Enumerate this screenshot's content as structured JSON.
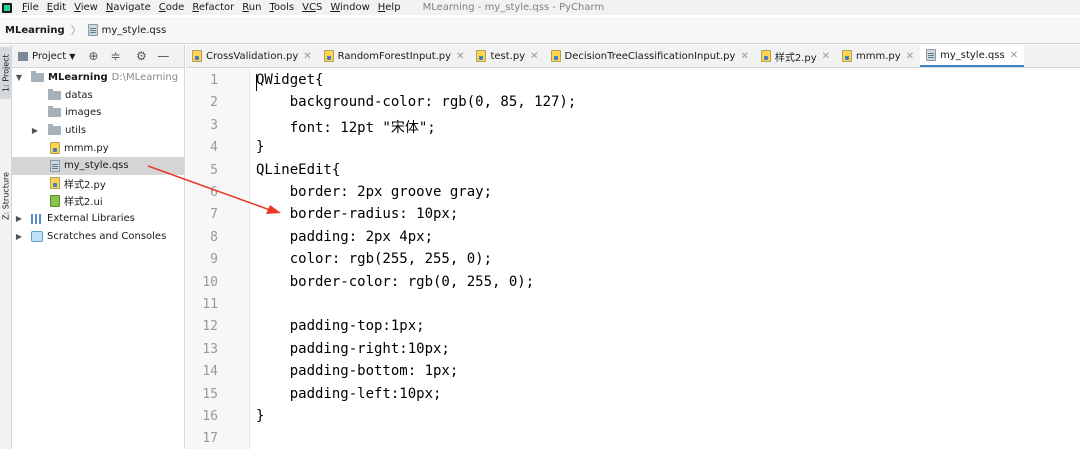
{
  "menubar": {
    "items": [
      {
        "first": "F",
        "rest": "ile"
      },
      {
        "first": "E",
        "rest": "dit"
      },
      {
        "first": "V",
        "rest": "iew"
      },
      {
        "first": "N",
        "rest": "avigate"
      },
      {
        "first": "C",
        "rest": "ode"
      },
      {
        "first": "R",
        "rest": "efactor"
      },
      {
        "first": "R",
        "rest": "un"
      },
      {
        "first": "T",
        "rest": "ools"
      },
      {
        "first": "VC",
        "rest": "S"
      },
      {
        "first": "W",
        "rest": "indow"
      },
      {
        "first": "H",
        "rest": "elp"
      }
    ],
    "window_title": "MLearning - my_style.qss - PyCharm"
  },
  "breadcrumb": {
    "project": "MLearning",
    "file": "my_style.qss"
  },
  "toolstrip": {
    "project_tab": "1: Project",
    "structure_tab": "Z: Structure"
  },
  "project_panel": {
    "title": "Project",
    "tree": [
      {
        "label": "MLearning",
        "path": "D:\\MLearning",
        "type": "folder",
        "expanded": true
      },
      {
        "label": "datas",
        "type": "folder"
      },
      {
        "label": "images",
        "type": "folder"
      },
      {
        "label": "utils",
        "type": "folder",
        "collapsed": true
      },
      {
        "label": "mmm.py",
        "type": "py"
      },
      {
        "label": "my_style.qss",
        "type": "qss",
        "selected": true
      },
      {
        "label": "样式2.py",
        "type": "py"
      },
      {
        "label": "样式2.ui",
        "type": "ui"
      },
      {
        "label": "External Libraries",
        "type": "lib"
      },
      {
        "label": "Scratches and Consoles",
        "type": "scratch"
      }
    ]
  },
  "tabs": [
    {
      "label": "CrossValidation.py"
    },
    {
      "label": "RandomForestInput.py"
    },
    {
      "label": "test.py"
    },
    {
      "label": "DecisionTreeClassificationInput.py"
    },
    {
      "label": "样式2.py"
    },
    {
      "label": "mmm.py"
    },
    {
      "label": "my_style.qss",
      "active": true
    }
  ],
  "editor": {
    "line_numbers": [
      "1",
      "2",
      "3",
      "4",
      "5",
      "6",
      "7",
      "8",
      "9",
      "10",
      "11",
      "12",
      "13",
      "14",
      "15",
      "16",
      "17"
    ],
    "lines": [
      "QWidget{",
      "    background-color: rgb(0, 85, 127);",
      "    font: 12pt \"宋体\";",
      "}",
      "QLineEdit{",
      "    border: 2px groove gray;",
      "    border-radius: 10px;",
      "    padding: 2px 4px;",
      "    color: rgb(255, 255, 0);",
      "    border-color: rgb(0, 255, 0);",
      "",
      "    padding-top:1px;",
      "    padding-right:10px;",
      "    padding-bottom: 1px;",
      "    padding-left:10px;",
      "}",
      ""
    ]
  },
  "colors": {
    "annotation_arrow": "#e8392a",
    "active_tab_underline": "#4083c9"
  }
}
